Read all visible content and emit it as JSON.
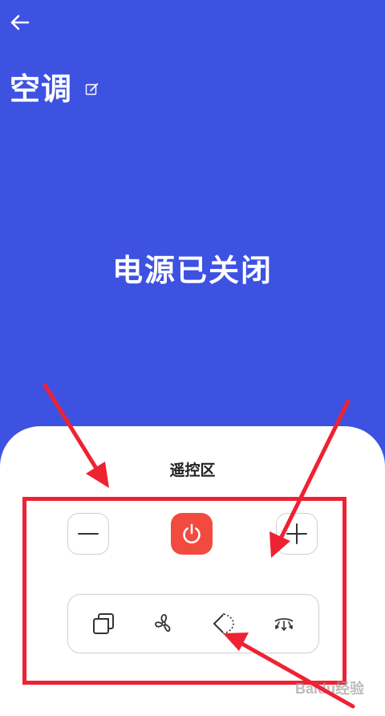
{
  "header": {
    "back_icon": "arrow-left-icon",
    "device_title": "空调",
    "edit_icon": "edit-icon"
  },
  "status": {
    "power_text": "电源已关闭"
  },
  "remote": {
    "title": "遥控区",
    "buttons": {
      "minus_icon": "minus-icon",
      "power_icon": "power-icon",
      "plus_icon": "plus-icon"
    },
    "modes": [
      {
        "name": "mode-icon"
      },
      {
        "name": "fan-speed-icon"
      },
      {
        "name": "swing-icon"
      },
      {
        "name": "airflow-direction-icon"
      }
    ]
  },
  "colors": {
    "background": "#3d52e1",
    "power_button": "#f34a3f",
    "annotation": "#ee2233"
  },
  "watermark": "Baidu经验"
}
